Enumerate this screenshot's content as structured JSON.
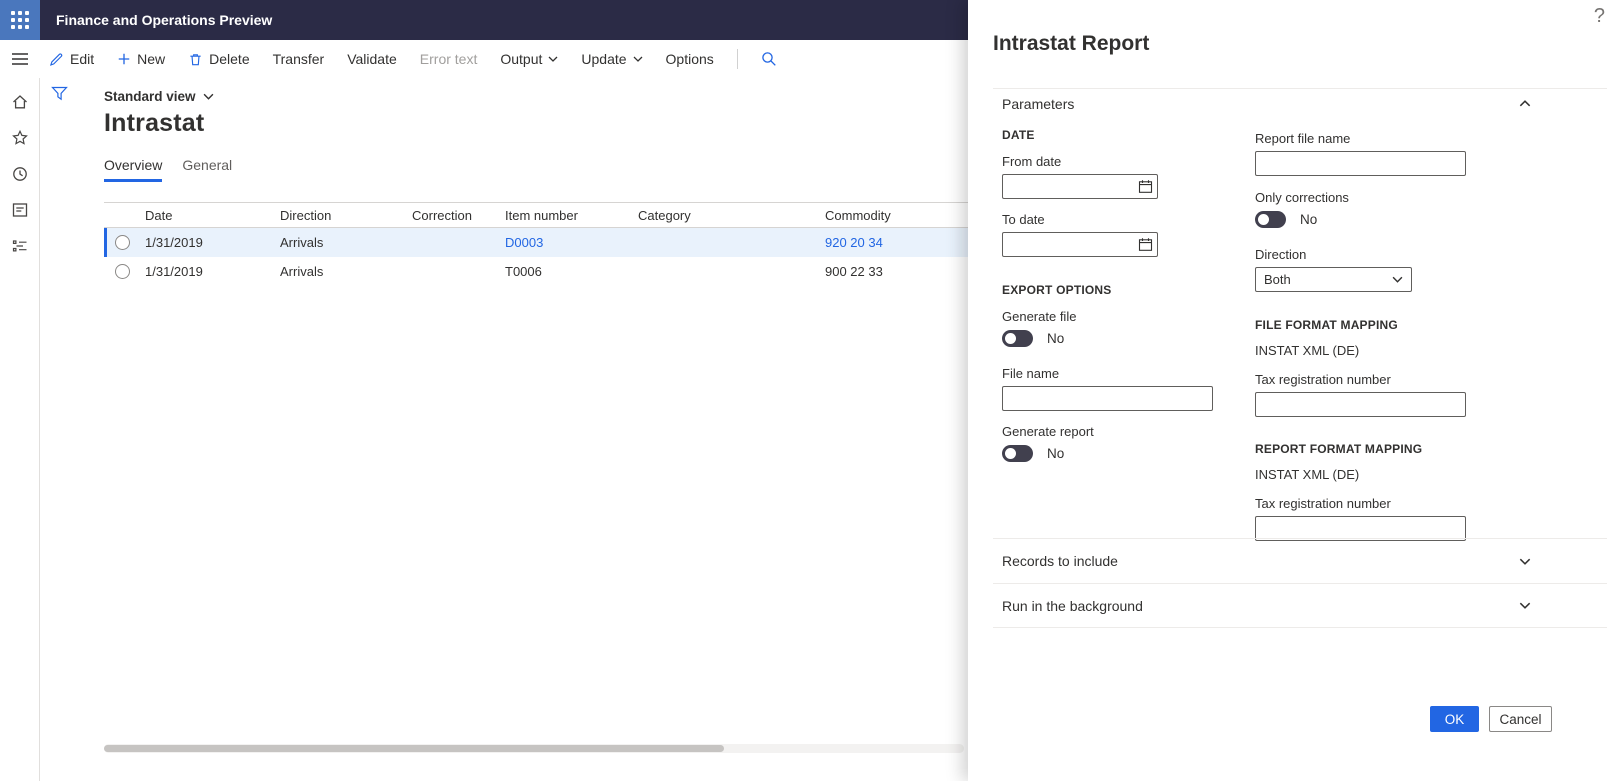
{
  "colors": {
    "accent": "#2266E3",
    "topbar": "#2b2b46",
    "waffle": "#4a77bd",
    "selected_row": "#e9f2fc"
  },
  "topbar": {
    "app_title": "Finance and Operations Preview"
  },
  "help_glyph": "?",
  "toolbar": {
    "edit": "Edit",
    "new": "New",
    "delete": "Delete",
    "transfer": "Transfer",
    "validate": "Validate",
    "error_text": "Error text",
    "output": "Output",
    "update": "Update",
    "options": "Options"
  },
  "main": {
    "view_selector": "Standard view",
    "page_title": "Intrastat",
    "tabs": {
      "overview": "Overview",
      "general": "General"
    },
    "grid": {
      "columns": {
        "date": "Date",
        "direction": "Direction",
        "correction": "Correction",
        "item_number": "Item number",
        "category": "Category",
        "commodity": "Commodity"
      },
      "rows": [
        {
          "date": "1/31/2019",
          "direction": "Arrivals",
          "correction": "",
          "item_number": "D0003",
          "category": "",
          "commodity": "920 20 34"
        },
        {
          "date": "1/31/2019",
          "direction": "Arrivals",
          "correction": "",
          "item_number": "T0006",
          "category": "",
          "commodity": "900 22 33"
        }
      ]
    }
  },
  "panel": {
    "title": "Intrastat Report",
    "parameters": {
      "header": "Parameters",
      "date": {
        "heading": "DATE",
        "from_label": "From date",
        "to_label": "To date"
      },
      "export": {
        "heading": "EXPORT OPTIONS",
        "generate_file_label": "Generate file",
        "generate_file_value": "No",
        "file_name_label": "File name",
        "generate_report_label": "Generate report",
        "generate_report_value": "No"
      },
      "report_file_name_label": "Report file name",
      "only_corrections_label": "Only corrections",
      "only_corrections_value": "No",
      "direction_label": "Direction",
      "direction_value": "Both",
      "file_format": {
        "heading": "FILE FORMAT MAPPING",
        "value": "INSTAT XML (DE)",
        "tax_label": "Tax registration number"
      },
      "report_format": {
        "heading": "REPORT FORMAT MAPPING",
        "value": "INSTAT XML (DE)",
        "tax_label": "Tax registration number"
      }
    },
    "records_section": "Records to include",
    "background_section": "Run in the background",
    "ok": "OK",
    "cancel": "Cancel"
  }
}
